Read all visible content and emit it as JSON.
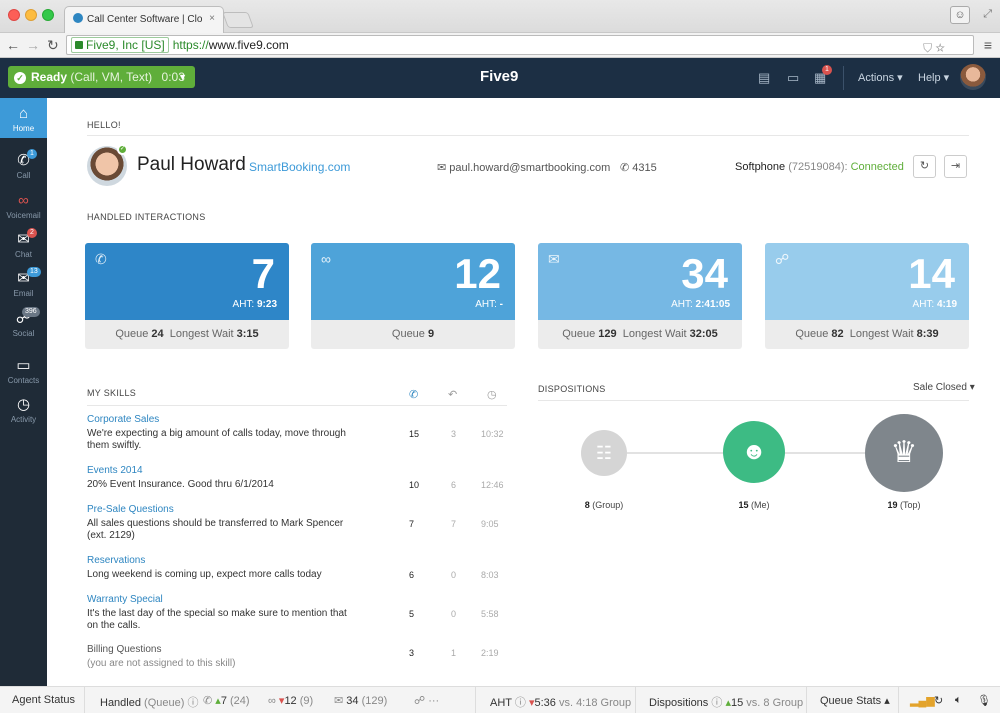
{
  "browser": {
    "tab_title": "Call Center Software | Clo",
    "tab_close": "×",
    "ev_badge": "Five9, Inc [US]",
    "url_protocol": "https://",
    "url_host": "www.five9.com"
  },
  "header": {
    "status": "Ready",
    "status_channels": "(Call, VM, Text)",
    "status_timer": "0:03",
    "logo": "Five9",
    "notification_count": "1",
    "actions_label": "Actions",
    "help_label": "Help"
  },
  "sidebar": {
    "items": [
      {
        "label": "Home",
        "icon": "home-icon",
        "glyph": "⌂",
        "badge": ""
      },
      {
        "label": "Call",
        "icon": "phone-icon",
        "glyph": "✆",
        "badge": "1"
      },
      {
        "label": "Voicemail",
        "icon": "voicemail-icon",
        "glyph": "∞",
        "badge": ""
      },
      {
        "label": "Chat",
        "icon": "chat-icon",
        "glyph": "✉",
        "badge": "2"
      },
      {
        "label": "Email",
        "icon": "email-icon",
        "glyph": "✉",
        "badge": "13"
      },
      {
        "label": "Social",
        "icon": "social-icon",
        "glyph": "☍",
        "badge": "396"
      },
      {
        "label": "Contacts",
        "icon": "folder-icon",
        "glyph": "▭",
        "badge": ""
      },
      {
        "label": "Activity",
        "icon": "clock-icon",
        "glyph": "◷",
        "badge": ""
      }
    ]
  },
  "agent": {
    "greeting": "HELLO!",
    "name": "Paul Howard",
    "company": "SmartBooking.com",
    "email": "paul.howard@smartbooking.com",
    "extension": "4315",
    "softphone_label": "Softphone",
    "softphone_number": "(72519084):",
    "softphone_status": "Connected"
  },
  "interactions": {
    "title": "HANDLED INTERACTIONS",
    "tiles": [
      {
        "icon": "phone-icon",
        "glyph": "✆",
        "count": "7",
        "aht_label": "AHT:",
        "aht": "9:23",
        "queue_label": "Queue",
        "queue": "24",
        "wait_label": "Longest Wait",
        "wait": "3:15",
        "color": "#2e86c8",
        "bottom": "#e6e6e6"
      },
      {
        "icon": "voicemail-icon",
        "glyph": "∞",
        "count": "12",
        "aht_label": "AHT:",
        "aht": "-",
        "queue_label": "Queue",
        "queue": "9",
        "wait_label": "",
        "wait": "",
        "color": "#4ea3d9",
        "bottom": "#e6e6e6"
      },
      {
        "icon": "email-icon",
        "glyph": "✉",
        "count": "34",
        "aht_label": "AHT:",
        "aht": "2:41:05",
        "queue_label": "Queue",
        "queue": "129",
        "wait_label": "Longest Wait",
        "wait": "32:05",
        "color": "#76b8e4",
        "bottom": "#e6e6e6"
      },
      {
        "icon": "social-icon",
        "glyph": "☍",
        "count": "14",
        "aht_label": "AHT:",
        "aht": "4:19",
        "queue_label": "Queue",
        "queue": "82",
        "wait_label": "Longest Wait",
        "wait": "8:39",
        "color": "#98ccec",
        "bottom": "#e6e6e6"
      }
    ]
  },
  "skills": {
    "title": "MY SKILLS",
    "rows": [
      {
        "name": "Corporate Sales",
        "desc": "We're expecting a big amount of calls today, move through them swiftly.",
        "calls": "15",
        "queue": "3",
        "time": "10:32",
        "assigned": true
      },
      {
        "name": "Events 2014",
        "desc": "20% Event Insurance. Good thru 6/1/2014",
        "calls": "10",
        "queue": "6",
        "time": "12:46",
        "assigned": true
      },
      {
        "name": "Pre-Sale Questions",
        "desc": "All sales questions should be transferred to Mark Spencer (ext. 2129)",
        "calls": "7",
        "queue": "7",
        "time": "9:05",
        "assigned": true
      },
      {
        "name": "Reservations",
        "desc": "Long weekend is coming up, expect more calls today",
        "calls": "6",
        "queue": "0",
        "time": "8:03",
        "assigned": true
      },
      {
        "name": "Warranty Special",
        "desc": "It's the last day of the special so make sure to mention that on the calls.",
        "calls": "5",
        "queue": "0",
        "time": "5:58",
        "assigned": true
      },
      {
        "name": "Billing Questions",
        "desc": "(you are not assigned to this skill)",
        "calls": "3",
        "queue": "1",
        "time": "2:19",
        "assigned": false
      }
    ]
  },
  "dispositions": {
    "title": "DISPOSITIONS",
    "filter": "Sale Closed",
    "nodes": [
      {
        "value": "8",
        "label": "(Group)",
        "icon": "group-icon",
        "color": "#d5d5d5"
      },
      {
        "value": "15",
        "label": "(Me)",
        "icon": "user-icon",
        "color": "#3dbb84"
      },
      {
        "value": "19",
        "label": "(Top)",
        "icon": "trophy-icon",
        "color": "#7f868c"
      }
    ]
  },
  "statusbar": {
    "agent_status": "Agent Status",
    "handled": "Handled",
    "queue_paren": "(Queue)",
    "calls": "7",
    "calls_queue": "(24)",
    "vm": "12",
    "vm_queue": "(9)",
    "email": "34",
    "email_queue": "(129)",
    "more": "···",
    "aht_label": "AHT",
    "aht_value": "5:36",
    "aht_vs": "vs. 4:18 Group",
    "disp_label": "Dispositions",
    "disp_value": "15",
    "disp_vs": "vs. 8 Group",
    "queue_stats": "Queue Stats"
  }
}
